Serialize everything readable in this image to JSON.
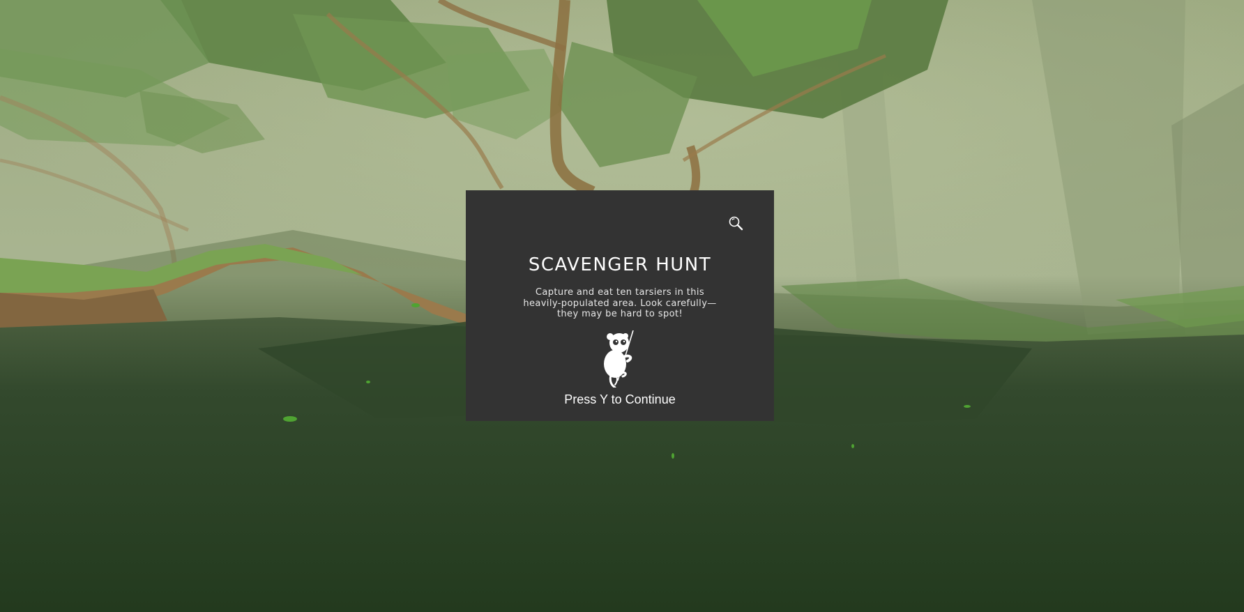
{
  "modal": {
    "title": "SCAVENGER HUNT",
    "description": "Capture and eat ten tarsiers in this heavily-populated area. Look carefully— they may be hard to spot!",
    "continue_prompt": "Press Y to Continue",
    "top_icon": "magnifying-glass-icon",
    "illustration": "tarsier-icon"
  },
  "colors": {
    "modal_background": "#333333",
    "modal_text": "#ffffff",
    "fog": "#a6b28c",
    "ground": "#2d4427",
    "foliage": "#6f9a4f",
    "branch": "#9b7b4c"
  }
}
